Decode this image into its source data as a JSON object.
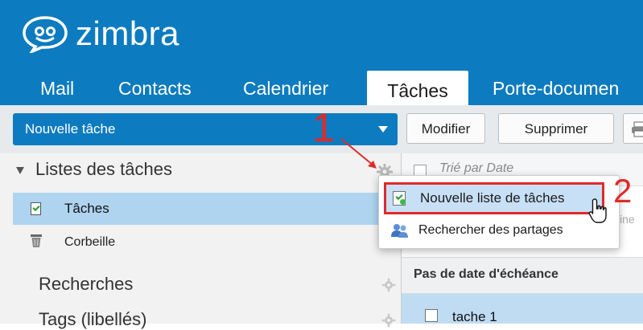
{
  "app": {
    "brand": "zimbra",
    "accent_color": "#0d7bbf",
    "annotation_color": "#e02a2a",
    "selected_color": "#aed4f0"
  },
  "tabs": [
    {
      "label": "Mail",
      "active": false
    },
    {
      "label": "Contacts",
      "active": false
    },
    {
      "label": "Calendrier",
      "active": false
    },
    {
      "label": "Tâches",
      "active": true
    },
    {
      "label": "Porte-documen",
      "active": false
    }
  ],
  "toolbar": {
    "new_label": "Nouvelle tâche",
    "edit_label": "Modifier",
    "delete_label": "Supprimer",
    "print_icon": "print-icon"
  },
  "sidebar": {
    "tasklists_header": "Listes des tâches",
    "items": [
      {
        "label": "Tâches",
        "icon": "task-list-icon",
        "selected": true
      },
      {
        "label": "Corbeille",
        "icon": "trash-icon",
        "selected": false
      }
    ],
    "searches_header": "Recherches",
    "tags_header": "Tags (libellés)"
  },
  "content": {
    "sort_label": "Trié par Date",
    "line_label": "ine",
    "group_header": "Pas de date d'échéance",
    "task_label": "tache 1"
  },
  "menu": {
    "items": [
      {
        "label": "Nouvelle liste de tâches",
        "icon": "new-task-list-icon",
        "highlighted": true
      },
      {
        "label": "Rechercher des partages",
        "icon": "find-shares-icon",
        "highlighted": false
      }
    ]
  },
  "annotations": {
    "step1": "1",
    "step2": "2"
  }
}
